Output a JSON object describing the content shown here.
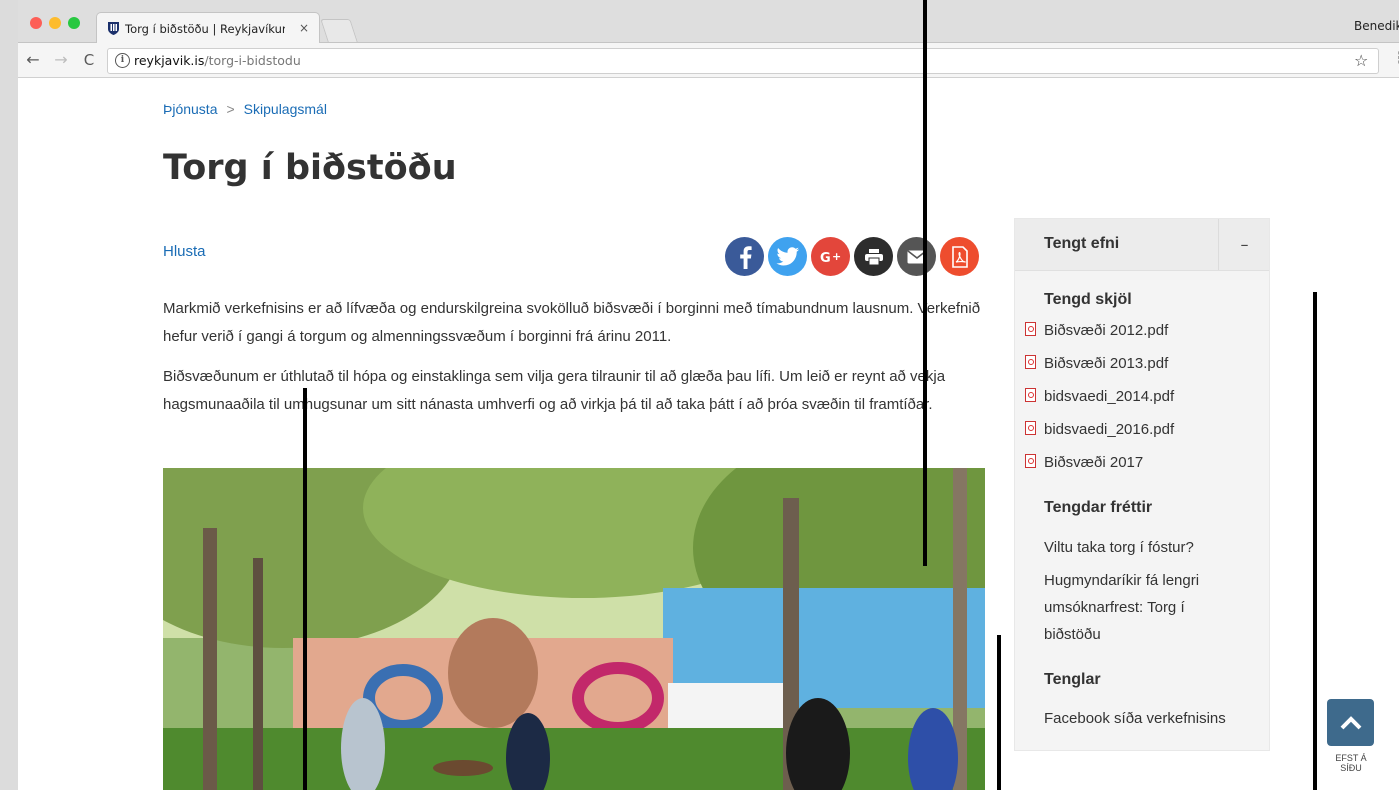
{
  "browser": {
    "tab_title": "Torg í biðstöðu | Reykjavíkurbo",
    "tab_close": "×",
    "profile_name": "Benedik",
    "url_host": "reykjavik.is",
    "url_path": "/torg-i-bidstodu"
  },
  "breadcrumb": {
    "items": [
      "Þjónusta",
      "Skipulagsmál"
    ],
    "separator": ">"
  },
  "page": {
    "title": "Torg í biðstöðu",
    "listen_label": "Hlusta",
    "paragraphs": [
      "Markmið verkefnisins er að lífvæða og endurskilgreina svokölluð biðsvæði í borginni með tímabundnum lausnum. Verkefnið hefur verið í gangi á torgum og almenningssvæðum í borginni  frá árinu 2011.",
      "Biðsvæðunum er úthlutað til hópa og einstaklinga sem vilja gera tilraunir til að glæða þau lífi. Um leið er reynt að vekja hagsmunaaðila til umhugsunar um sitt nánasta umhverfi og að virkja þá til að taka þátt í að þróa svæðin til framtíðar."
    ],
    "share_icons": [
      "facebook-icon",
      "twitter-icon",
      "google-plus-icon",
      "print-icon",
      "email-icon",
      "pdf-icon"
    ]
  },
  "sidebar": {
    "header": "Tengt efni",
    "toggle": "–",
    "documents_heading": "Tengd skjöl",
    "documents": [
      "Biðsvæði 2012.pdf",
      "Biðsvæði 2013.pdf",
      "bidsvaedi_2014.pdf",
      "bidsvaedi_2016.pdf",
      "Biðsvæði 2017"
    ],
    "news_heading": "Tengdar fréttir",
    "news": [
      "Viltu taka torg í fóstur?",
      "Hugmyndaríkir fá lengri umsóknarfrest: Torg í biðstöðu"
    ],
    "links_heading": "Tenglar",
    "links": [
      "Facebook síða verkefnisins"
    ]
  },
  "back_to_top": {
    "label_line1": "EFST Á",
    "label_line2": "SÍÐU"
  },
  "colors": {
    "link": "#1a6cb5",
    "back_to_top_bg": "#3e6a8c",
    "facebook": "#3a5a99",
    "twitter": "#3fa2ef",
    "google_plus": "#e3463b",
    "pdf_share": "#ee4d2e"
  }
}
